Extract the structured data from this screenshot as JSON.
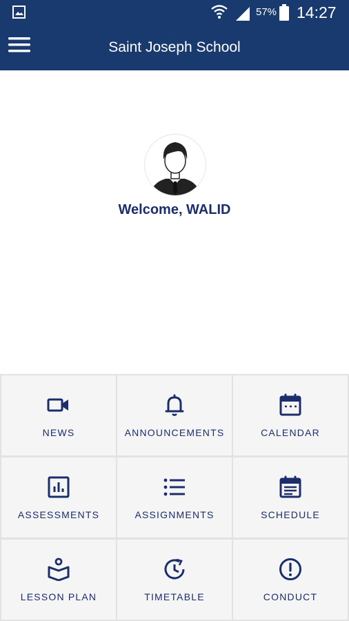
{
  "status_bar": {
    "battery_percent": "57%",
    "time": "14:27",
    "icons": [
      "gallery-icon",
      "wifi-icon",
      "signal-icon",
      "battery-icon"
    ]
  },
  "app_bar": {
    "title": "Saint Joseph School",
    "menu_icon": "menu-icon"
  },
  "profile": {
    "welcome": "Welcome, WALID",
    "avatar_icon": "user-avatar-icon"
  },
  "menu": [
    {
      "label": "NEWS",
      "icon": "video-camera-icon"
    },
    {
      "label": "ANNOUNCEMENTS",
      "icon": "bell-icon"
    },
    {
      "label": "CALENDAR",
      "icon": "calendar-icon"
    },
    {
      "label": "ASSESSMENTS",
      "icon": "bar-chart-icon"
    },
    {
      "label": "ASSIGNMENTS",
      "icon": "list-icon"
    },
    {
      "label": "SCHEDULE",
      "icon": "schedule-icon"
    },
    {
      "label": "LESSON PLAN",
      "icon": "book-reader-icon"
    },
    {
      "label": "TIMETABLE",
      "icon": "history-clock-icon"
    },
    {
      "label": "CONDUCT",
      "icon": "alert-circle-icon"
    }
  ],
  "colors": {
    "primary": "#183a6e",
    "text_dark": "#1b2d6b",
    "tile_bg": "#f5f5f5",
    "grid_line": "#e2e2e2"
  }
}
